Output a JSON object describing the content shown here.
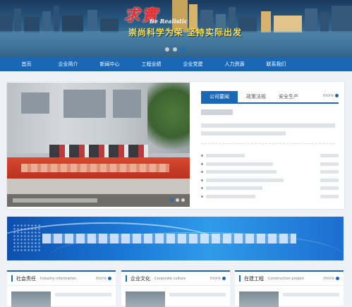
{
  "banner": {
    "slogan_main": "求實",
    "slogan_en": "Be Realistic",
    "slogan_sub": "崇尚科学为荣 坚持实际出发",
    "dots": 3,
    "active_dot": 3
  },
  "nav": {
    "items": [
      "首页",
      "企业简介",
      "新闻中心",
      "工程业绩",
      "企业党建",
      "人力资源",
      "联系我们"
    ]
  },
  "news": {
    "tabs": [
      "公司要闻",
      "政策法规",
      "安全生产"
    ],
    "active_tab": 0,
    "more": "more"
  },
  "photo": {
    "dots": 3,
    "active_dot": 1
  },
  "cards": [
    {
      "title": "社会责任",
      "en": "Industry information",
      "more": "more"
    },
    {
      "title": "企业文化",
      "en": "Corporate culture",
      "more": "more"
    },
    {
      "title": "在建工程",
      "en": "Construction project",
      "more": "more"
    }
  ],
  "colors": {
    "primary": "#1a67b6",
    "slogan_red": "#e82c2c",
    "slogan_yellow": "#ffe24a"
  }
}
